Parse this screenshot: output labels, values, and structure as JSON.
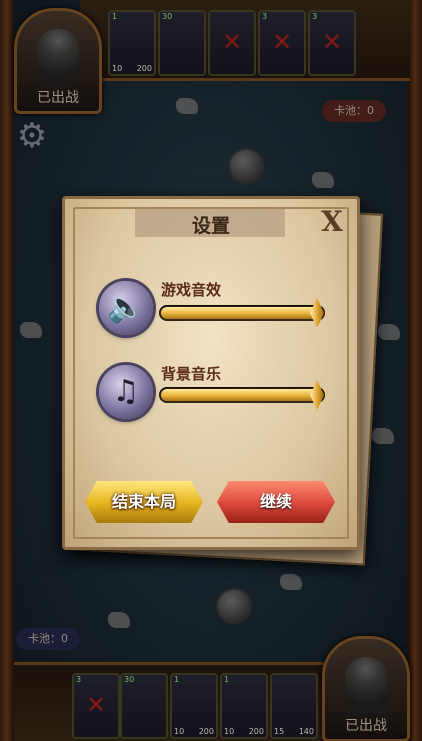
{
  "settings": {
    "title": "设置",
    "close_label": "X",
    "sound_effects_label": "游戏音效",
    "sound_effects_level": 0.97,
    "music_label": "背景音乐",
    "music_level": 0.97,
    "end_button_label": "结束本局",
    "continue_button_label": "继续"
  },
  "top": {
    "hero_status": "已出战",
    "card_pool": "卡池：0",
    "cards": [
      {
        "cost": "1",
        "left": "10",
        "right": "200",
        "icon": "knight-icon"
      },
      {
        "cost": "30",
        "left": "",
        "right": "",
        "icon": "hourglass-icon"
      },
      {
        "cost": "",
        "left": "",
        "right": "",
        "icon": "locked-card-icon"
      },
      {
        "cost": "3",
        "left": "",
        "right": "",
        "icon": "locked-card-icon"
      },
      {
        "cost": "3",
        "left": "",
        "right": "",
        "icon": "locked-card-icon"
      }
    ]
  },
  "bottom": {
    "hero_status": "已出战",
    "card_pool": "卡池：0",
    "cards": [
      {
        "cost": "3",
        "left": "",
        "right": "",
        "icon": "locked-card-icon"
      },
      {
        "cost": "30",
        "left": "",
        "right": "",
        "icon": "hourglass-icon"
      },
      {
        "cost": "1",
        "left": "10",
        "right": "200",
        "icon": "knight-icon"
      },
      {
        "cost": "1",
        "left": "10",
        "right": "200",
        "icon": "knight-icon"
      },
      {
        "cost": "",
        "left": "15",
        "right": "140",
        "icon": "elf-icon"
      }
    ]
  },
  "icons": {
    "settings": "gear-icon",
    "sfx": "speaker-icon",
    "music": "music-note-icon"
  },
  "colors": {
    "end_button": "#e3b21e",
    "continue_button": "#d8473a",
    "panel": "#e6d3ae"
  }
}
